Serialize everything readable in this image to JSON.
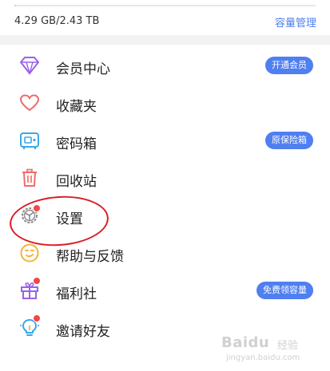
{
  "storage": {
    "used_text": "4.29 GB/2.43 TB",
    "manage_link": "容量管理",
    "usage_fraction": 0.0017
  },
  "menu": {
    "items": [
      {
        "label": "会员中心",
        "icon": "diamond-icon",
        "pill": "开通会员"
      },
      {
        "label": "收藏夹",
        "icon": "heart-icon"
      },
      {
        "label": "密码箱",
        "icon": "safe-icon",
        "pill": "原保险箱"
      },
      {
        "label": "回收站",
        "icon": "trash-icon"
      },
      {
        "label": "设置",
        "icon": "gear-icon",
        "badge": true
      },
      {
        "label": "帮助与反馈",
        "icon": "smiley-icon"
      },
      {
        "label": "福利社",
        "icon": "gift-icon",
        "badge": true,
        "pill": "免费领容量"
      },
      {
        "label": "邀请好友",
        "icon": "lightbulb-icon",
        "badge": true
      }
    ]
  },
  "watermark": {
    "brand": "Baidu",
    "sub": "经验",
    "url": "jingyan.baidu.com"
  },
  "colors": {
    "accent": "#4f7ff0",
    "badge": "#f04848",
    "annotation": "#d81f24"
  }
}
